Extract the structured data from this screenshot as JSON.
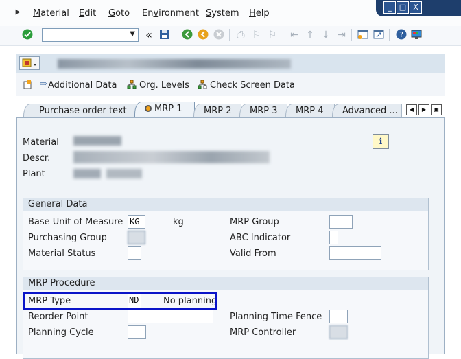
{
  "menu": {
    "items": [
      "Material",
      "Edit",
      "Goto",
      "Environment",
      "System",
      "Help"
    ],
    "underline": [
      "M",
      "E",
      "G",
      "v",
      "S",
      "H"
    ]
  },
  "window_controls": [
    "_",
    "□",
    "X"
  ],
  "toolbar": {
    "command_field_value": "",
    "back_glyph": "«"
  },
  "app_toolbar": {
    "additional_data": "Additional Data",
    "org_levels": "Org. Levels",
    "check_screen_data": "Check Screen Data"
  },
  "tabs": [
    {
      "label": "Purchase order text",
      "active": false
    },
    {
      "label": "MRP 1",
      "active": true
    },
    {
      "label": "MRP 2",
      "active": false
    },
    {
      "label": "MRP 3",
      "active": false
    },
    {
      "label": "MRP 4",
      "active": false
    },
    {
      "label": "Advanced ...",
      "active": false
    }
  ],
  "header": {
    "material_label": "Material",
    "descr_label": "Descr.",
    "plant_label": "Plant",
    "info_glyph": "i"
  },
  "general_data": {
    "title": "General Data",
    "base_uom_label": "Base Unit of Measure",
    "base_uom_value": "KG",
    "base_uom_text": "kg",
    "purchasing_group_label": "Purchasing Group",
    "material_status_label": "Material Status",
    "mrp_group_label": "MRP Group",
    "abc_indicator_label": "ABC Indicator",
    "valid_from_label": "Valid From"
  },
  "mrp_procedure": {
    "title": "MRP Procedure",
    "mrp_type_label": "MRP Type",
    "mrp_type_value": "ND",
    "mrp_type_text": "No planning",
    "reorder_point_label": "Reorder Point",
    "planning_cycle_label": "Planning Cycle",
    "planning_time_fence_label": "Planning Time Fence",
    "mrp_controller_label": "MRP Controller"
  },
  "colors": {
    "highlight": "#0a14c8",
    "window_bar": "#1e3e6c",
    "ok_icon": "#2a9d3a"
  }
}
